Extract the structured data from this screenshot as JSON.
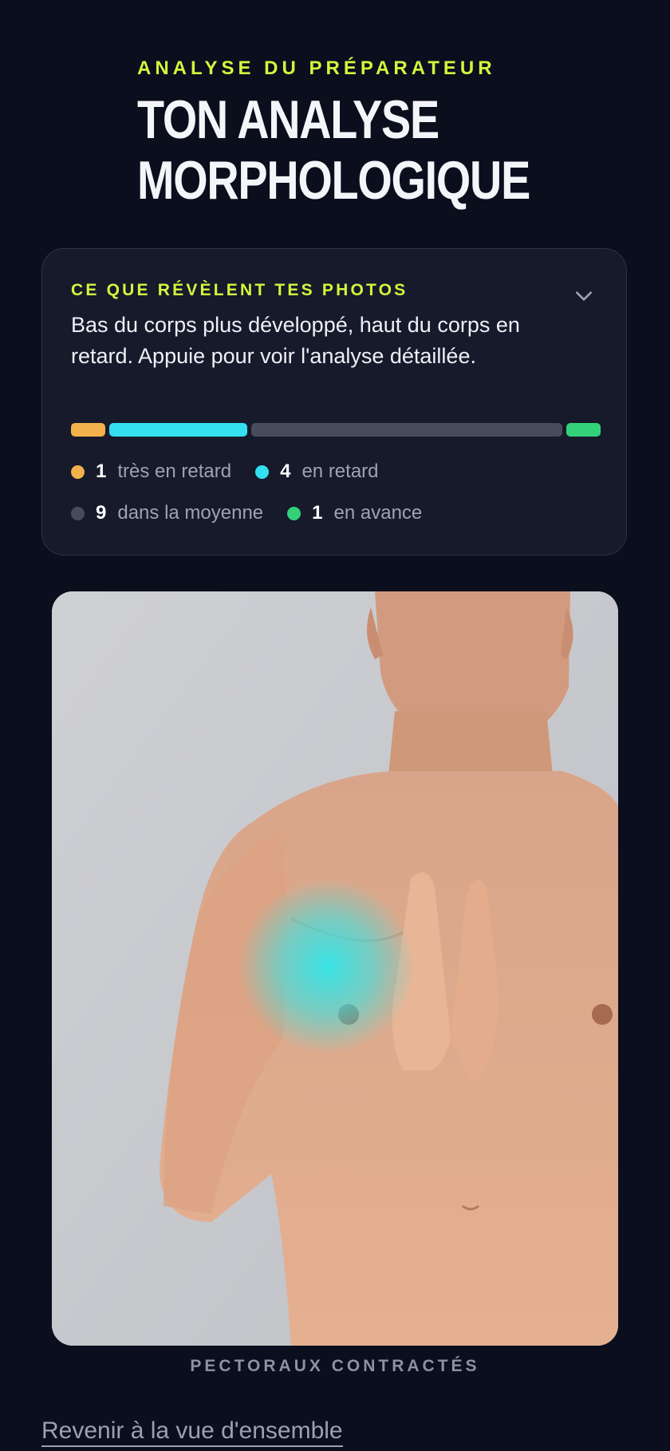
{
  "header": {
    "eyebrow": "ANALYSE DU PRÉPARATEUR",
    "title_line1": "TON ANALYSE",
    "title_line2": "MORPHOLOGIQUE"
  },
  "summary": {
    "label": "CE QUE RÉVÈLENT TES PHOTOS",
    "text": "Bas du corps plus développé, haut du corps en retard. Appuie pour voir l'analyse détaillée.",
    "expand_icon": "chevron-down-icon",
    "categories": [
      {
        "key": "tres_en_retard",
        "count": "1",
        "label": "très en retard",
        "color": "#f3b14c"
      },
      {
        "key": "en_retard",
        "count": "4",
        "label": "en retard",
        "color": "#34dff0"
      },
      {
        "key": "dans_la_moyenne",
        "count": "9",
        "label": "dans la moyenne",
        "color": "#474c5c"
      },
      {
        "key": "en_avance",
        "count": "1",
        "label": "en avance",
        "color": "#33d17a"
      }
    ]
  },
  "photo": {
    "caption": "PECTORAUX CONTRACTÉS",
    "highlight_color": "#2fe6ea"
  },
  "footer": {
    "back_link": "Revenir à la vue d'ensemble"
  }
}
